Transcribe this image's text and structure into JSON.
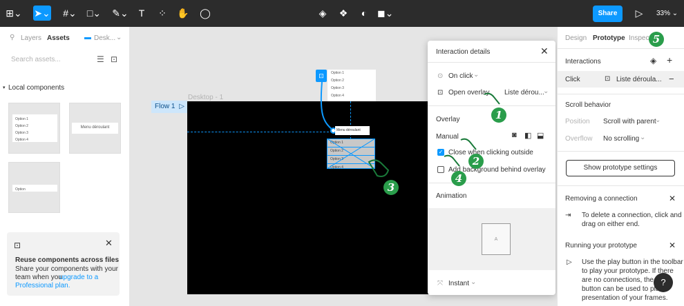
{
  "toolbar": {
    "share_label": "Share",
    "zoom_label": "33%",
    "zoom_chevron": "⌄"
  },
  "left_panel": {
    "tabs": {
      "layers": "Layers",
      "assets": "Assets",
      "page": "Desk..."
    },
    "search_placeholder": "Search assets...",
    "local_components_label": "Local components",
    "components": [
      {
        "options": [
          "Option 1",
          "Option 2",
          "Option 3",
          "Option 4"
        ]
      },
      {
        "label": "Menu déroulant"
      },
      {
        "label": "Option"
      }
    ],
    "promo": {
      "title": "Reuse components across files",
      "body_1": "Share your components with your",
      "body_2": "team when you",
      "link_1": "upgrade to a",
      "link_2": "Professional plan."
    }
  },
  "canvas": {
    "frame_label": "Desktop - 1",
    "flow_label": "Flow 1",
    "options_list": [
      "Option 1",
      "Option 2",
      "Option 3",
      "Option 4"
    ],
    "menu_label": "Menu déroulant",
    "selected_options": [
      "Option 1",
      "Option 2",
      "Option 3",
      "Option 4"
    ]
  },
  "dialog": {
    "title": "Interaction details",
    "trigger": "On click",
    "action": "Open overlay",
    "destination": "Liste dérou...",
    "overlay_label": "Overlay",
    "overlay_position": "Manual",
    "close_outside_label": "Close when clicking outside",
    "add_background_label": "Add background behind overlay",
    "animation_label": "Animation",
    "animation_preview_letter": "A",
    "animation_type": "Instant"
  },
  "right_panel": {
    "tabs": {
      "design": "Design",
      "prototype": "Prototype",
      "inspect": "Inspect"
    },
    "interactions_label": "Interactions",
    "interaction_trigger": "Click",
    "interaction_target": "Liste déroula...",
    "scroll_behavior_label": "Scroll behavior",
    "position_label": "Position",
    "position_value": "Scroll with parent",
    "overflow_label": "Overflow",
    "overflow_value": "No scrolling",
    "show_settings_button": "Show prototype settings",
    "removing_title": "Removing a connection",
    "removing_body_1": "To delete a connection, click and",
    "removing_body_2": "drag on either end.",
    "running_title": "Running your prototype",
    "running_body_1": "Use the play button in the toolbar",
    "running_body_2": "to play your prototype. If there",
    "running_body_3": "are no connections, the pl",
    "running_body_4": "button can be used to pla",
    "running_body_5": "presentation of your frames.",
    "help_label": "?"
  },
  "annotations": [
    "1",
    "2",
    "3",
    "4",
    "5"
  ]
}
